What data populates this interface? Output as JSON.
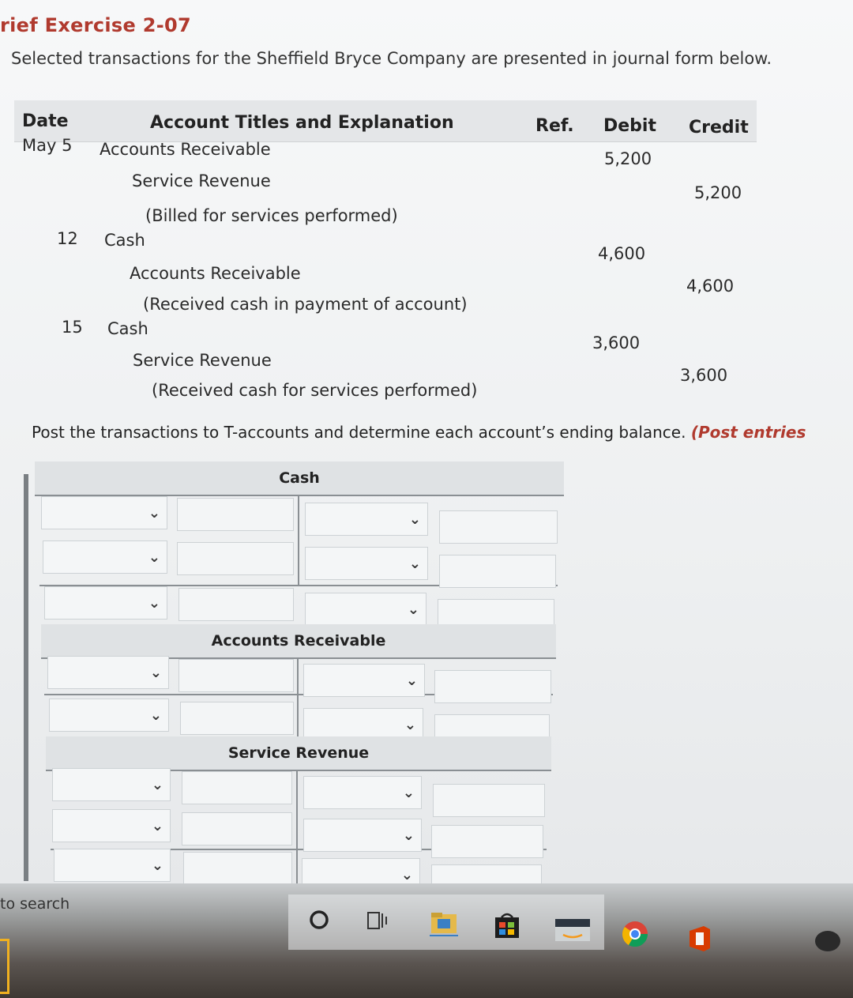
{
  "header": {
    "title": "rief Exercise 2-07",
    "subtitle": "Selected transactions for the Sheffield Bryce Company are presented in journal form below."
  },
  "journal": {
    "columns": {
      "date": "Date",
      "account": "Account Titles and Explanation",
      "ref": "Ref.",
      "debit": "Debit",
      "credit": "Credit"
    },
    "entries": [
      {
        "date": "May 5",
        "debit_account": "Accounts Receivable",
        "credit_account": "Service Revenue",
        "explanation": "(Billed for services performed)",
        "debit": "5,200",
        "credit": "5,200"
      },
      {
        "date": "12",
        "debit_account": "Cash",
        "credit_account": "Accounts Receivable",
        "explanation": "(Received cash in payment of account)",
        "debit": "4,600",
        "credit": "4,600"
      },
      {
        "date": "15",
        "debit_account": "Cash",
        "credit_account": "Service Revenue",
        "explanation": "(Received cash for services performed)",
        "debit": "3,600",
        "credit": "3,600"
      }
    ]
  },
  "instructions": {
    "text": "Post the transactions to T-accounts and determine each account’s ending balance.",
    "emphasis": "(Post entries"
  },
  "t_accounts": [
    {
      "name": "Cash",
      "rows": 3
    },
    {
      "name": "Accounts Receivable",
      "rows": 2
    },
    {
      "name": "Service Revenue",
      "rows": 3
    }
  ],
  "taskbar": {
    "search_text": "to search"
  },
  "colors": {
    "accent_red": "#b03a2e"
  }
}
